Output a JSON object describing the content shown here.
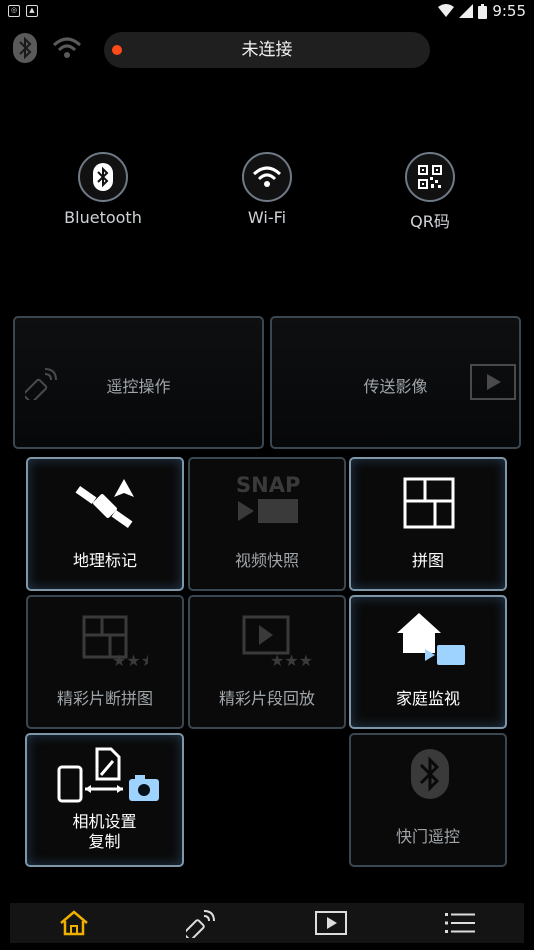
{
  "status_bar": {
    "time": "9:55"
  },
  "connection": {
    "status_text": "未连接",
    "status_color": "#ff4a1a"
  },
  "connect_options": [
    {
      "label": "Bluetooth",
      "icon": "bluetooth-icon"
    },
    {
      "label": "Wi-Fi",
      "icon": "wifi-icon"
    },
    {
      "label": "QR码",
      "icon": "qr-code-icon"
    }
  ],
  "tiles": {
    "remote_operation": "遥控操作",
    "transfer_images": "传送影像",
    "geotag": "地理标记",
    "snap_movie": "视频快照",
    "snap_icon_text": "SNAP",
    "collage": "拼图",
    "highlight_collage": "精彩片断拼图",
    "highlight_playback": "精彩片段回放",
    "home_monitor": "家庭监视",
    "copy_settings": "相机设置\n复制",
    "shutter_remote": "快门遥控"
  },
  "bottom_nav": [
    {
      "icon": "home-icon",
      "active": true
    },
    {
      "icon": "remote-icon",
      "active": false
    },
    {
      "icon": "playback-icon",
      "active": false
    },
    {
      "icon": "menu-icon",
      "active": false
    }
  ],
  "colors": {
    "accent_home": "#f0b000",
    "tile_border": "#3a4650",
    "tile_active_border": "#7d96a8"
  }
}
